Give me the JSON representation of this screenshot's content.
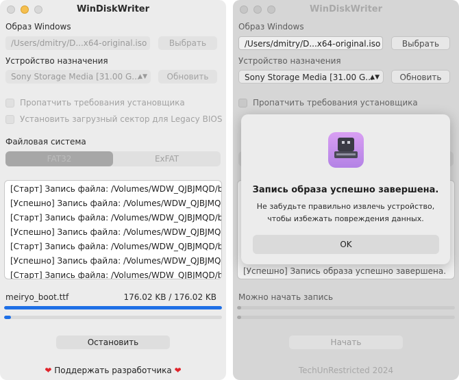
{
  "app_title": "WinDiskWriter",
  "left": {
    "image_label": "Образ Windows",
    "image_path": "/Users/dmitry/D...x64-original.iso",
    "choose_button": "Выбрать",
    "device_label": "Устройство назначения",
    "device_value": "Sony Storage Media [31.00 G...",
    "refresh_button": "Обновить",
    "patch_option": "Пропатчить требования установщика",
    "legacy_option": "Установить загрузный сектор для Legacy BIOS",
    "filesystem_label": "Файловая система",
    "fs_options": [
      "FAT32",
      "ExFAT"
    ],
    "selected_fs": "FAT32",
    "log_lines": [
      "[Старт] Запись файла: /Volumes/WDW_QJBJMQD/boot/",
      "[Успешно] Запись файла: /Volumes/WDW_QJBJMQD/boot/",
      "[Старт] Запись файла: /Volumes/WDW_QJBJMQD/boot/",
      "[Успешно] Запись файла: /Volumes/WDW_QJBJMQD/boot/",
      "[Старт] Запись файла: /Volumes/WDW_QJBJMQD/boot/",
      "[Успешно] Запись файла: /Volumes/WDW_QJBJMQD/boot/",
      "[Старт] Запись файла: /Volumes/WDW_QJBJMQD/boot/"
    ],
    "current_file": "meiryo_boot.ttf",
    "file_progress_text": "176.02 KB  /  176.02 KB",
    "file_progress_fraction": 1.0,
    "total_progress_fraction": 0.03,
    "stop_button": "Остановить",
    "support": "Поддержать разработчика",
    "heart_icon": "heart-icon"
  },
  "right": {
    "image_label": "Образ Windows",
    "image_path": "/Users/dmitry/D...x64-original.iso",
    "choose_button": "Выбрать",
    "device_label": "Устройство назначения",
    "device_value": "Sony Storage Media [31.00 G...",
    "refresh_button": "Обновить",
    "patch_option": "Пропатчить требования установщика",
    "log_last_line": "[Успешно] Запись образа успешно завершена.",
    "status_text": "Можно начать запись",
    "start_button": "Начать",
    "footer": "TechUnRestricted 2024"
  },
  "dialog": {
    "title": "Запись образа успешно завершена.",
    "message": "Не забудьте правильно извлечь устройство, чтобы избежать повреждения данных.",
    "ok_button": "OK",
    "icon": "usb-drive-icon"
  },
  "colors": {
    "accent": "#1e6fe6",
    "dialog_icon": "#c893ee",
    "heart": "#e0242b"
  }
}
